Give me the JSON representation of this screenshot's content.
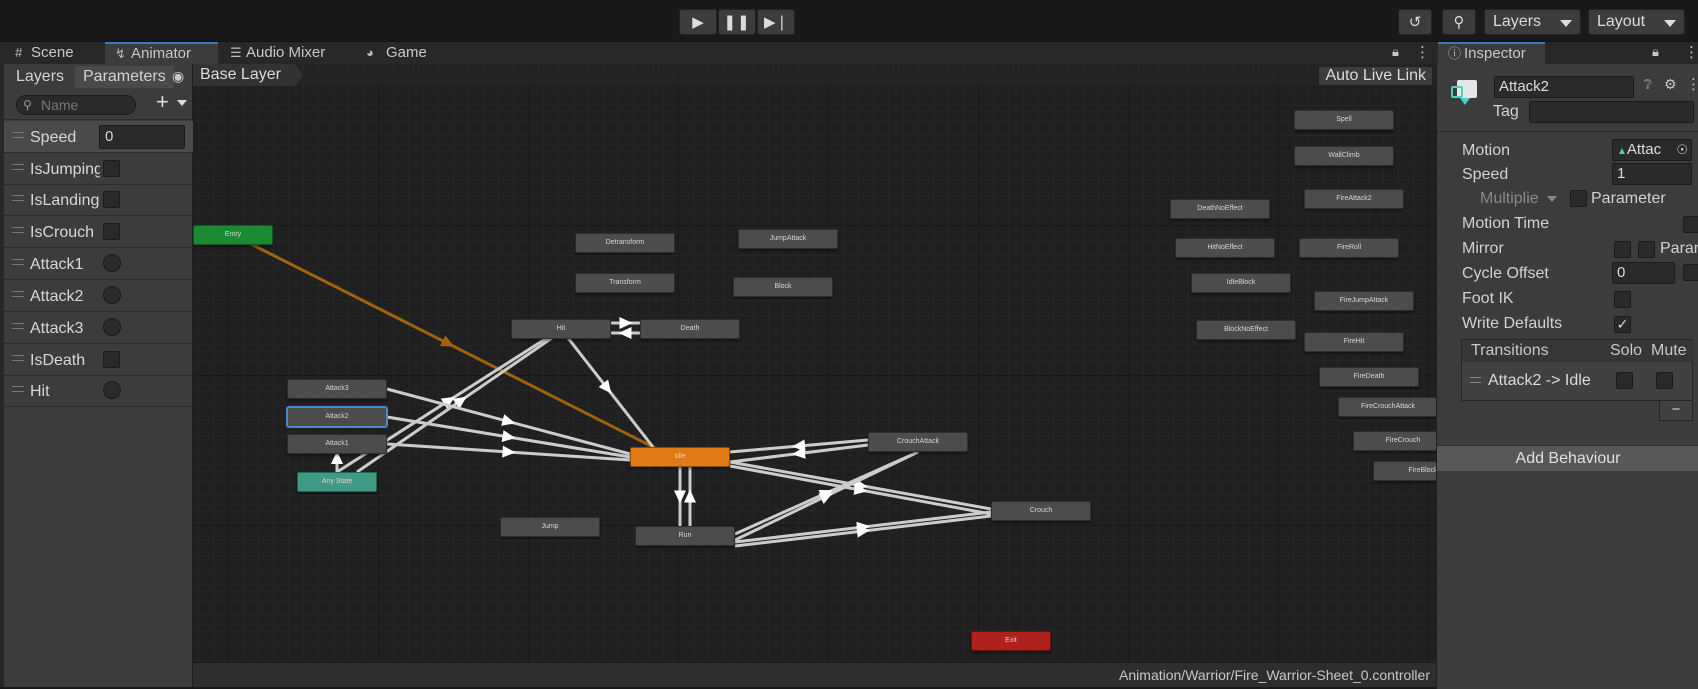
{
  "toolbar": {
    "play_icon": "play-icon",
    "pause_icon": "pause-icon",
    "step_icon": "step-icon",
    "history_icon": "history-icon",
    "search_icon": "search-icon",
    "layers_dropdown": "Layers",
    "layout_dropdown": "Layout"
  },
  "tabs": [
    {
      "label": "Scene",
      "icon": "grid-icon"
    },
    {
      "label": "Animator",
      "icon": "animator-icon",
      "active": true
    },
    {
      "label": "Audio Mixer",
      "icon": "mixer-icon"
    },
    {
      "label": "Game",
      "icon": "gamepad-icon"
    }
  ],
  "inspector_tab": {
    "label": "Inspector",
    "icon": "info-icon"
  },
  "params_panel": {
    "tab_layers": "Layers",
    "tab_parameters": "Parameters",
    "search_placeholder": "Name",
    "add_label": "+",
    "parameters": [
      {
        "name": "Speed",
        "type": "float",
        "value": "0"
      },
      {
        "name": "IsJumping",
        "type": "bool"
      },
      {
        "name": "IsLanding",
        "type": "bool"
      },
      {
        "name": "IsCrouch",
        "type": "bool"
      },
      {
        "name": "Attack1",
        "type": "trigger"
      },
      {
        "name": "Attack2",
        "type": "trigger"
      },
      {
        "name": "Attack3",
        "type": "trigger"
      },
      {
        "name": "IsDeath",
        "type": "bool"
      },
      {
        "name": "Hit",
        "type": "trigger"
      }
    ]
  },
  "graph": {
    "breadcrumb": "Base Layer",
    "auto_live_link": "Auto Live Link",
    "status_path": "Animation/Warrior/Fire_Warrior-Sheet_0.controller",
    "nodes": [
      {
        "name": "Entry",
        "kind": "entry"
      },
      {
        "name": "Any State",
        "kind": "any"
      },
      {
        "name": "Exit",
        "kind": "exit"
      },
      {
        "name": "Idle",
        "kind": "default"
      },
      {
        "name": "Attack3",
        "kind": "state"
      },
      {
        "name": "Attack2",
        "kind": "selected"
      },
      {
        "name": "Attack1",
        "kind": "state"
      },
      {
        "name": "Hit",
        "kind": "state"
      },
      {
        "name": "Death",
        "kind": "state"
      },
      {
        "name": "Detransform",
        "kind": "state"
      },
      {
        "name": "Transform",
        "kind": "state"
      },
      {
        "name": "JumpAttack",
        "kind": "state"
      },
      {
        "name": "Block",
        "kind": "state"
      },
      {
        "name": "CrouchAttack",
        "kind": "state"
      },
      {
        "name": "Crouch",
        "kind": "state"
      },
      {
        "name": "Run",
        "kind": "state"
      },
      {
        "name": "Jump",
        "kind": "state"
      },
      {
        "name": "Spell",
        "kind": "state"
      },
      {
        "name": "WallClimb",
        "kind": "state"
      },
      {
        "name": "FireAttack2",
        "kind": "state"
      },
      {
        "name": "DeathNoEffect",
        "kind": "state"
      },
      {
        "name": "HitNoEffect",
        "kind": "state"
      },
      {
        "name": "FireRoll",
        "kind": "state"
      },
      {
        "name": "IdleBlock",
        "kind": "state"
      },
      {
        "name": "FireJumpAttack",
        "kind": "state"
      },
      {
        "name": "BlockNoEffect",
        "kind": "state"
      },
      {
        "name": "FireHit",
        "kind": "state"
      },
      {
        "name": "FireDeath",
        "kind": "state"
      },
      {
        "name": "FireCrouchAttack",
        "kind": "state"
      },
      {
        "name": "FireCrouch",
        "kind": "state"
      },
      {
        "name": "FireBlock",
        "kind": "state"
      }
    ]
  },
  "inspector": {
    "state_name": "Attack2",
    "tag_label": "Tag",
    "tag_value": "",
    "motion_label": "Motion",
    "motion_value": "Attac",
    "speed_label": "Speed",
    "speed_value": "1",
    "multiplier_label": "Multiplie",
    "parameter_label": "Parameter",
    "motion_time_label": "Motion Time",
    "mirror_label": "Mirror",
    "mirror_param_label": "Paran",
    "cycle_offset_label": "Cycle Offset",
    "cycle_offset_value": "0",
    "foot_ik_label": "Foot IK",
    "write_defaults_label": "Write Defaults",
    "write_defaults_checked": true,
    "transitions_header": "Transitions",
    "solo_label": "Solo",
    "mute_label": "Mute",
    "transitions": [
      {
        "label": "Attack2 -> Idle"
      }
    ],
    "remove_label": "−",
    "add_behaviour": "Add Behaviour"
  }
}
